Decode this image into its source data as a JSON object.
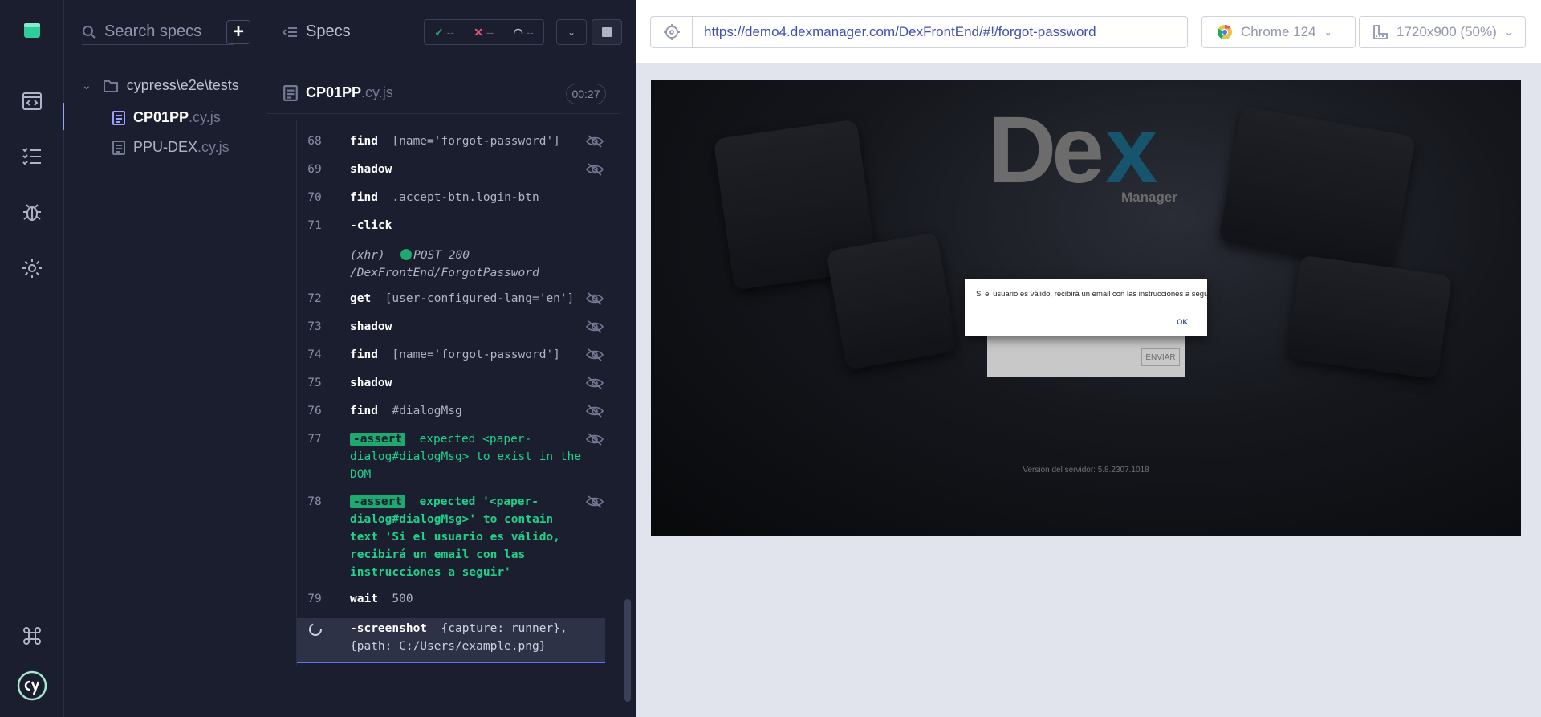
{
  "specs_panel": {
    "search_placeholder": "Search specs",
    "folder": "cypress\\e2e\\tests",
    "files": [
      {
        "name": "CP01PP",
        "ext": ".cy.js"
      },
      {
        "name": "PPU-DEX",
        "ext": ".cy.js"
      }
    ]
  },
  "reporter": {
    "title": "Specs",
    "passed": "--",
    "failed": "--",
    "pending": "--",
    "spec_name": "CP01PP",
    "spec_ext": ".cy.js",
    "duration": "00:27",
    "commands": [
      {
        "num": "68",
        "cmd": "find",
        "arg": "[name='forgot-password']"
      },
      {
        "num": "69",
        "cmd": "shadow",
        "arg": ""
      },
      {
        "num": "70",
        "cmd": "find",
        "arg": ".accept-btn.login-btn"
      },
      {
        "num": "71",
        "cmd": "-click",
        "arg": ""
      },
      {
        "num": "",
        "cmd": "(xhr)",
        "arg": "POST 200 /DexFrontEnd/ForgotPassword"
      },
      {
        "num": "72",
        "cmd": "get",
        "arg": "[user-configured-lang='en']"
      },
      {
        "num": "73",
        "cmd": "shadow",
        "arg": ""
      },
      {
        "num": "74",
        "cmd": "find",
        "arg": "[name='forgot-password']"
      },
      {
        "num": "75",
        "cmd": "shadow",
        "arg": ""
      },
      {
        "num": "76",
        "cmd": "find",
        "arg": "#dialogMsg"
      },
      {
        "num": "77",
        "cmd": "-assert",
        "arg": "expected <paper-dialog#dialogMsg> to exist in the DOM"
      },
      {
        "num": "78",
        "cmd": "-assert",
        "arg": "expected '<paper-dialog#dialogMsg>' to contain text 'Si el usuario es válido, recibirá un email con las instrucciones a seguir'"
      },
      {
        "num": "79",
        "cmd": "wait",
        "arg": "500"
      },
      {
        "num": "",
        "cmd": "-screenshot",
        "arg": "{capture: runner}, {path: C:/Users/example.png}"
      }
    ]
  },
  "viewport": {
    "url": "https://demo4.dexmanager.com/DexFrontEnd/#!/forgot-password",
    "browser": "Chrome 124",
    "size": "1720x900 (50%)"
  },
  "aut": {
    "logo_main": "De",
    "logo_x": "x",
    "logo_sub": "Manager",
    "dialog_text": "Si el usuario es válido, recibirá un email con las instrucciones a seguir",
    "dialog_ok": "OK",
    "send_button": "ENVIAR",
    "version": "Versión del servidor: 5.8.2307.1018"
  }
}
